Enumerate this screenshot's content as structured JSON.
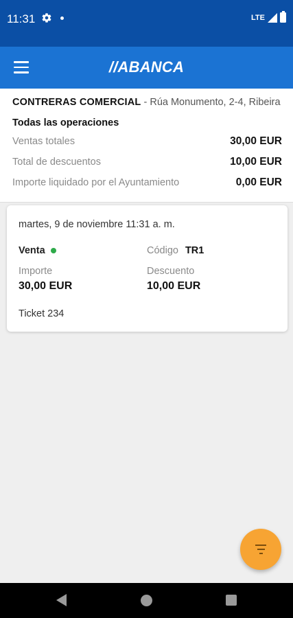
{
  "status_bar": {
    "time": "11:31",
    "network": "LTE",
    "icons": [
      "gear-icon",
      "notification-dot-icon",
      "signal-icon",
      "battery-icon"
    ]
  },
  "app_bar": {
    "brand": "//ABANCA",
    "menu_icon": "hamburger-menu-icon",
    "color": "#1b73d3"
  },
  "summary": {
    "merchant_name": "CONTRERAS COMERCIAL",
    "merchant_address": " - Rúa Monumento, 2-4, Ribeira",
    "section_title": "Todas las operaciones",
    "rows": [
      {
        "label": "Ventas totales",
        "value": "30,00 EUR"
      },
      {
        "label": "Total de descuentos",
        "value": "10,00 EUR"
      },
      {
        "label": "Importe liquidado por el Ayuntamiento",
        "value": "0,00 EUR"
      }
    ]
  },
  "operation": {
    "date": "martes, 9 de noviembre 11:31 a. m.",
    "type": "Venta",
    "status_color": "#2eaa4a",
    "code_label": "Código",
    "code_value": "TR1",
    "amount_label": "Importe",
    "amount_value": "30,00 EUR",
    "discount_label": "Descuento",
    "discount_value": "10,00 EUR",
    "ticket": "Ticket 234"
  },
  "fab": {
    "icon": "filter-icon",
    "color": "#f7a433"
  },
  "nav_bar": {
    "icons": [
      "back-icon",
      "home-icon",
      "recents-icon"
    ]
  }
}
